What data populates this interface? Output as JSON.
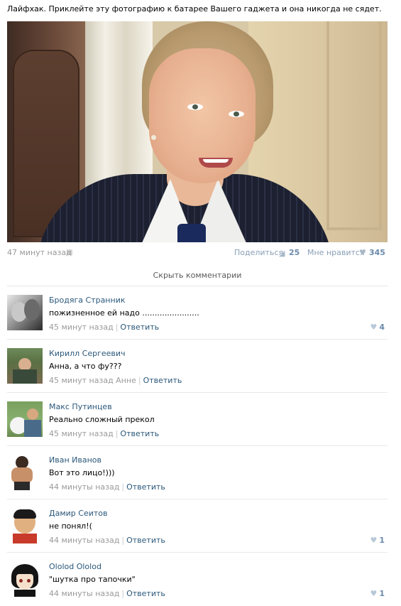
{
  "post": {
    "text": "Лайфхак. Приклейте эту фотографию к батарее Вашего гаджета и она никогда не сядет.",
    "time": "47 минут назад",
    "share_label": "Поделиться",
    "share_count": "25",
    "like_label": "Мне нравится",
    "like_count": "345"
  },
  "hide_comments": "Скрыть комментарии",
  "comments": [
    {
      "author": "Бродяга Странник",
      "text": "пожизненное ей надо .......................",
      "time": "45 минут назад",
      "reply": "Ответить",
      "likes": "4"
    },
    {
      "author": "Кирилл Сергеевич",
      "text": "Анна, а что фу???",
      "time": "45 минут назад Анне",
      "reply": "Ответить",
      "likes": ""
    },
    {
      "author": "Макс Путинцев",
      "text": "Реально сложный прекол",
      "time": "45 минут назад",
      "reply": "Ответить",
      "likes": ""
    },
    {
      "author": "Иван Иванов",
      "text": "Вот это лицо!)))",
      "time": "44 минуты назад",
      "reply": "Ответить",
      "likes": ""
    },
    {
      "author": "Дамир Сеитов",
      "text": "не понял!(",
      "time": "44 минуты назад",
      "reply": "Ответить",
      "likes": "1"
    },
    {
      "author": "Ololod Ololod",
      "text": "\"шутка про тапочки\"",
      "time": "44 минуты назад",
      "reply": "Ответить",
      "likes": "1"
    }
  ],
  "icons": {
    "android": "android-icon",
    "share": "megaphone-icon",
    "like": "heart-icon"
  },
  "colors": {
    "link": "#2b587a",
    "muted": "#9a9a9a",
    "count": "#6b8aab"
  }
}
